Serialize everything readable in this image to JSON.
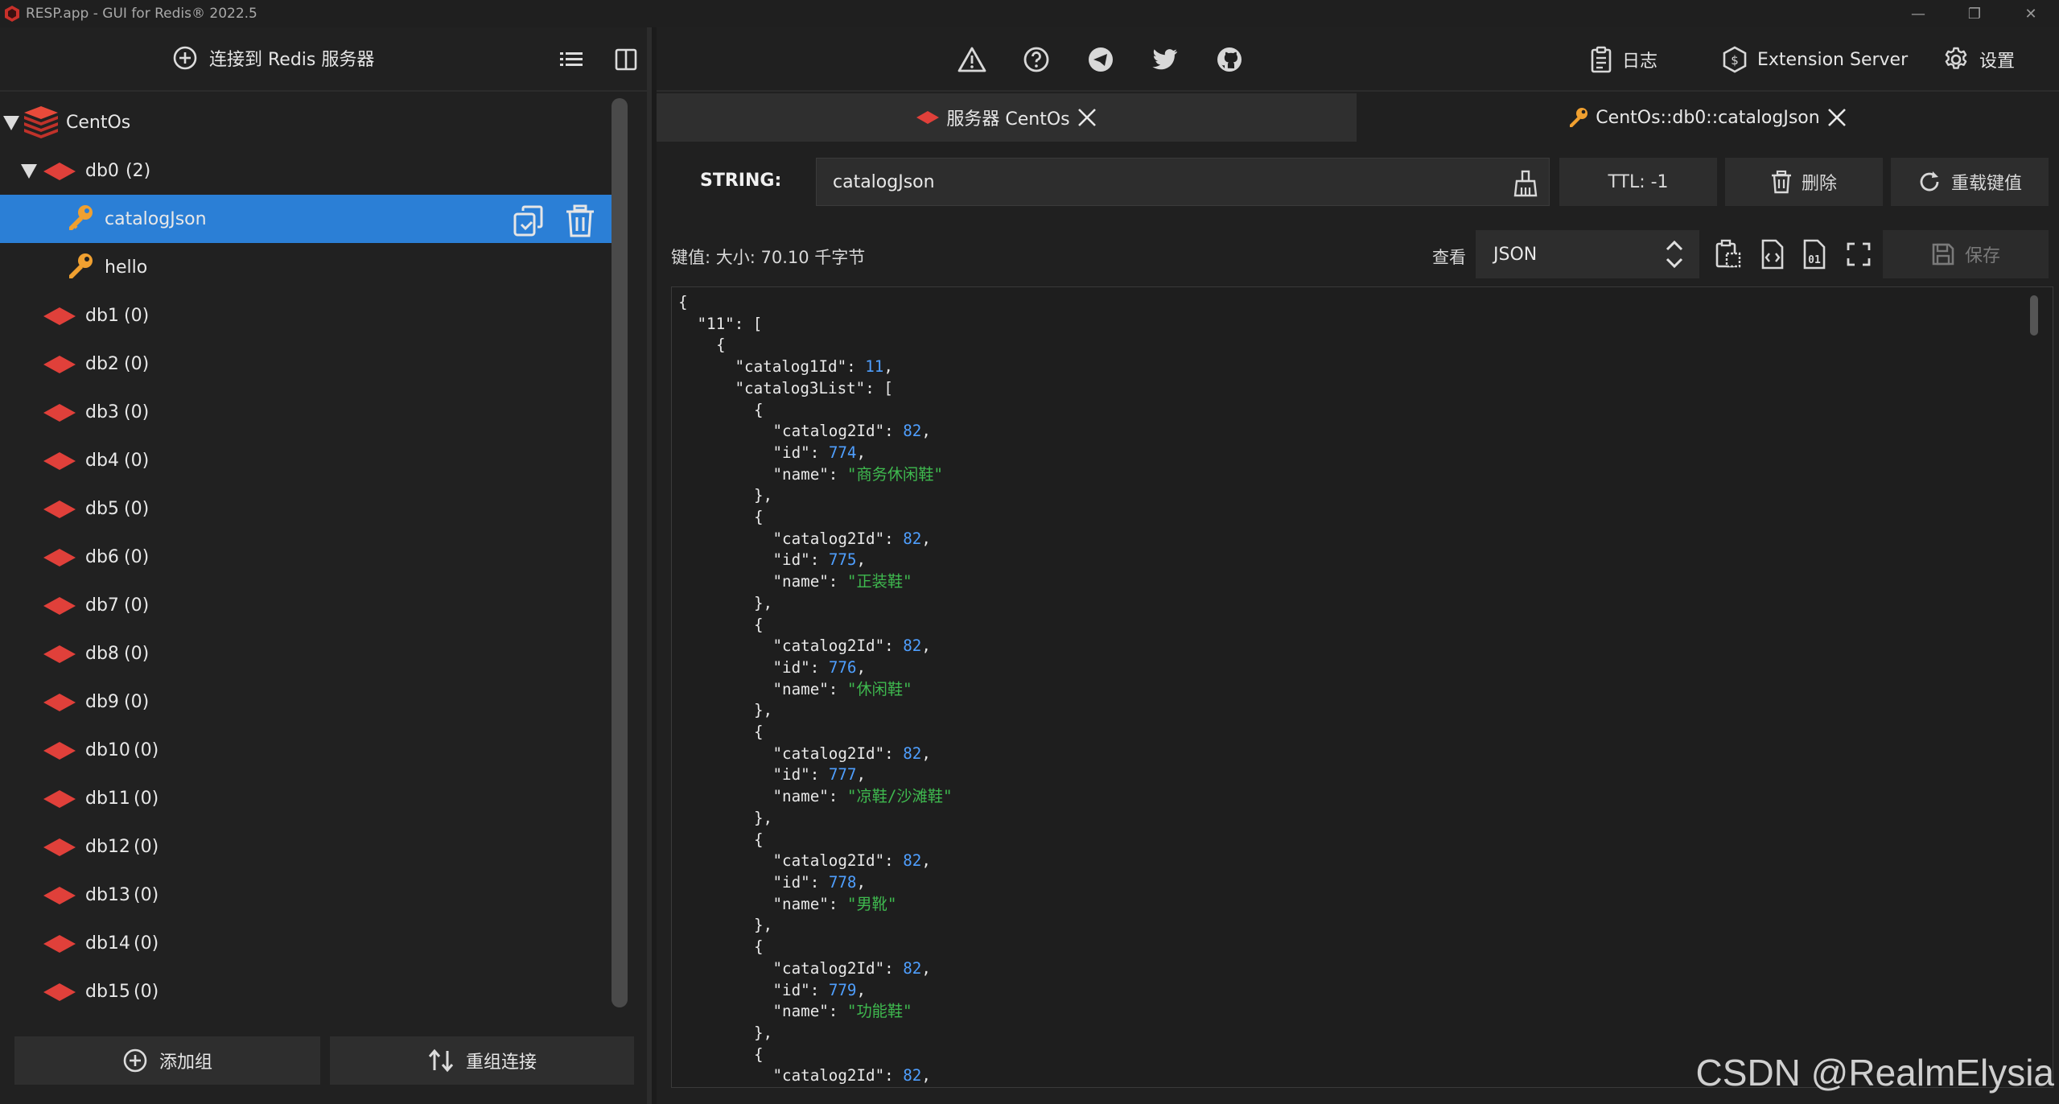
{
  "window": {
    "title": "RESP.app - GUI for Redis® 2022.5",
    "controls": [
      "minimize",
      "restore",
      "close"
    ]
  },
  "left_panel": {
    "connect_button": "连接到 Redis 服务器",
    "tree": {
      "server": "CentOs",
      "dbs": [
        {
          "name": "db0",
          "count": "(2)",
          "expanded": true,
          "keys": [
            "catalogJson",
            "hello"
          ]
        },
        {
          "name": "db1",
          "count": "(0)"
        },
        {
          "name": "db2",
          "count": "(0)"
        },
        {
          "name": "db3",
          "count": "(0)"
        },
        {
          "name": "db4",
          "count": "(0)"
        },
        {
          "name": "db5",
          "count": "(0)"
        },
        {
          "name": "db6",
          "count": "(0)"
        },
        {
          "name": "db7",
          "count": "(0)"
        },
        {
          "name": "db8",
          "count": "(0)"
        },
        {
          "name": "db9",
          "count": "(0)"
        },
        {
          "name": "db10",
          "count": "(0)"
        },
        {
          "name": "db11",
          "count": "(0)"
        },
        {
          "name": "db12",
          "count": "(0)"
        },
        {
          "name": "db13",
          "count": "(0)"
        },
        {
          "name": "db14",
          "count": "(0)"
        },
        {
          "name": "db15",
          "count": "(0)"
        }
      ],
      "selected_key": "catalogJson"
    },
    "add_group_button": "添加组",
    "reconnect_button": "重组连接"
  },
  "toolbar": {
    "log_button": "日志",
    "extension_button": "Extension Server",
    "settings_button": "设置"
  },
  "tabs": [
    {
      "label": "服务器 CentOs",
      "active": false
    },
    {
      "label": "CentOs::db0::catalogJson",
      "active": true
    }
  ],
  "key_view": {
    "type_label": "STRING:",
    "key_name": "catalogJson",
    "ttl_label": "TTL:  -1",
    "delete_button": "删除",
    "reload_button": "重载键值",
    "meta_text": "键值: 大小: 70.10 千字节",
    "view_label": "查看",
    "view_mode": "JSON",
    "save_button": "保存"
  },
  "json_value": [
    {
      "indent": 0,
      "parts": [
        [
          "k",
          "{"
        ]
      ]
    },
    {
      "indent": 1,
      "parts": [
        [
          "k",
          "\"11\": ["
        ]
      ]
    },
    {
      "indent": 2,
      "parts": [
        [
          "k",
          "{"
        ]
      ]
    },
    {
      "indent": 3,
      "parts": [
        [
          "k",
          "\"catalog1Id\": "
        ],
        [
          "n",
          "11"
        ],
        [
          "k",
          ","
        ]
      ]
    },
    {
      "indent": 3,
      "parts": [
        [
          "k",
          "\"catalog3List\": ["
        ]
      ]
    },
    {
      "indent": 4,
      "parts": [
        [
          "k",
          "{"
        ]
      ]
    },
    {
      "indent": 5,
      "parts": [
        [
          "k",
          "\"catalog2Id\": "
        ],
        [
          "n",
          "82"
        ],
        [
          "k",
          ","
        ]
      ]
    },
    {
      "indent": 5,
      "parts": [
        [
          "k",
          "\"id\": "
        ],
        [
          "n",
          "774"
        ],
        [
          "k",
          ","
        ]
      ]
    },
    {
      "indent": 5,
      "parts": [
        [
          "k",
          "\"name\": "
        ],
        [
          "s",
          "\"商务休闲鞋\""
        ]
      ]
    },
    {
      "indent": 4,
      "parts": [
        [
          "k",
          "},"
        ]
      ]
    },
    {
      "indent": 4,
      "parts": [
        [
          "k",
          "{"
        ]
      ]
    },
    {
      "indent": 5,
      "parts": [
        [
          "k",
          "\"catalog2Id\": "
        ],
        [
          "n",
          "82"
        ],
        [
          "k",
          ","
        ]
      ]
    },
    {
      "indent": 5,
      "parts": [
        [
          "k",
          "\"id\": "
        ],
        [
          "n",
          "775"
        ],
        [
          "k",
          ","
        ]
      ]
    },
    {
      "indent": 5,
      "parts": [
        [
          "k",
          "\"name\": "
        ],
        [
          "s",
          "\"正装鞋\""
        ]
      ]
    },
    {
      "indent": 4,
      "parts": [
        [
          "k",
          "},"
        ]
      ]
    },
    {
      "indent": 4,
      "parts": [
        [
          "k",
          "{"
        ]
      ]
    },
    {
      "indent": 5,
      "parts": [
        [
          "k",
          "\"catalog2Id\": "
        ],
        [
          "n",
          "82"
        ],
        [
          "k",
          ","
        ]
      ]
    },
    {
      "indent": 5,
      "parts": [
        [
          "k",
          "\"id\": "
        ],
        [
          "n",
          "776"
        ],
        [
          "k",
          ","
        ]
      ]
    },
    {
      "indent": 5,
      "parts": [
        [
          "k",
          "\"name\": "
        ],
        [
          "s",
          "\"休闲鞋\""
        ]
      ]
    },
    {
      "indent": 4,
      "parts": [
        [
          "k",
          "},"
        ]
      ]
    },
    {
      "indent": 4,
      "parts": [
        [
          "k",
          "{"
        ]
      ]
    },
    {
      "indent": 5,
      "parts": [
        [
          "k",
          "\"catalog2Id\": "
        ],
        [
          "n",
          "82"
        ],
        [
          "k",
          ","
        ]
      ]
    },
    {
      "indent": 5,
      "parts": [
        [
          "k",
          "\"id\": "
        ],
        [
          "n",
          "777"
        ],
        [
          "k",
          ","
        ]
      ]
    },
    {
      "indent": 5,
      "parts": [
        [
          "k",
          "\"name\": "
        ],
        [
          "s",
          "\"凉鞋/沙滩鞋\""
        ]
      ]
    },
    {
      "indent": 4,
      "parts": [
        [
          "k",
          "},"
        ]
      ]
    },
    {
      "indent": 4,
      "parts": [
        [
          "k",
          "{"
        ]
      ]
    },
    {
      "indent": 5,
      "parts": [
        [
          "k",
          "\"catalog2Id\": "
        ],
        [
          "n",
          "82"
        ],
        [
          "k",
          ","
        ]
      ]
    },
    {
      "indent": 5,
      "parts": [
        [
          "k",
          "\"id\": "
        ],
        [
          "n",
          "778"
        ],
        [
          "k",
          ","
        ]
      ]
    },
    {
      "indent": 5,
      "parts": [
        [
          "k",
          "\"name\": "
        ],
        [
          "s",
          "\"男靴\""
        ]
      ]
    },
    {
      "indent": 4,
      "parts": [
        [
          "k",
          "},"
        ]
      ]
    },
    {
      "indent": 4,
      "parts": [
        [
          "k",
          "{"
        ]
      ]
    },
    {
      "indent": 5,
      "parts": [
        [
          "k",
          "\"catalog2Id\": "
        ],
        [
          "n",
          "82"
        ],
        [
          "k",
          ","
        ]
      ]
    },
    {
      "indent": 5,
      "parts": [
        [
          "k",
          "\"id\": "
        ],
        [
          "n",
          "779"
        ],
        [
          "k",
          ","
        ]
      ]
    },
    {
      "indent": 5,
      "parts": [
        [
          "k",
          "\"name\": "
        ],
        [
          "s",
          "\"功能鞋\""
        ]
      ]
    },
    {
      "indent": 4,
      "parts": [
        [
          "k",
          "},"
        ]
      ]
    },
    {
      "indent": 4,
      "parts": [
        [
          "k",
          "{"
        ]
      ]
    },
    {
      "indent": 5,
      "parts": [
        [
          "k",
          "\"catalog2Id\": "
        ],
        [
          "n",
          "82"
        ],
        [
          "k",
          ","
        ]
      ]
    }
  ],
  "watermark": "CSDN @RealmElysia",
  "colors": {
    "accent": "#2b7fd6",
    "redis_red": "#d83b3b",
    "key_orange": "#f0a030",
    "json_number": "#4f9fff",
    "json_string": "#3fb94f"
  }
}
